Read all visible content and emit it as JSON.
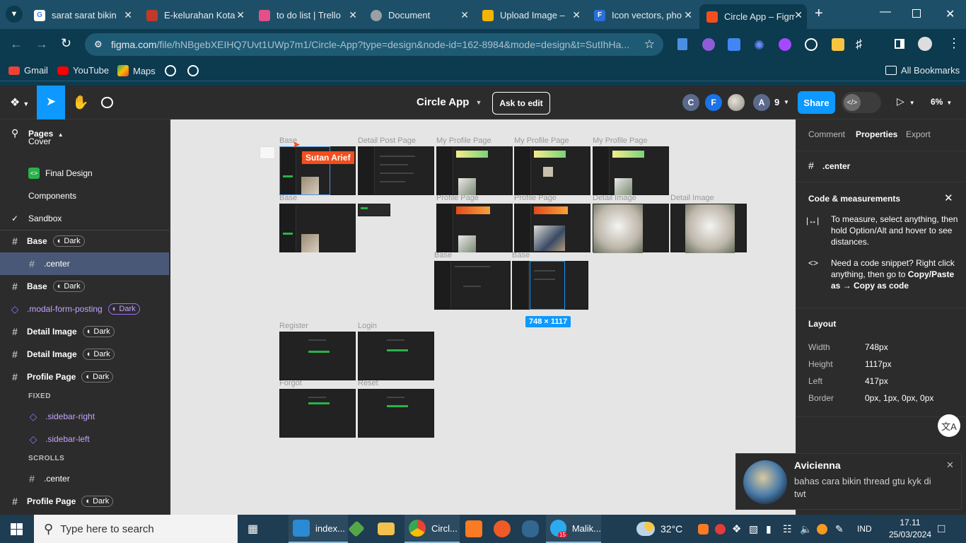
{
  "browser": {
    "tabs": [
      {
        "title": "sarat sarat bikin",
        "icon": "google-icon",
        "color": "#ffffff"
      },
      {
        "title": "E-kelurahan Kota",
        "icon": "site-icon",
        "color": "#c0392b"
      },
      {
        "title": "to do list | Trello",
        "icon": "trello-icon",
        "color": "#e44f8a"
      },
      {
        "title": "Document",
        "icon": "globe-icon",
        "color": "#9aa0a6"
      },
      {
        "title": "Upload Image –",
        "icon": "upload-icon",
        "color": "#f5b400"
      },
      {
        "title": "Icon vectors, pho",
        "icon": "flaticon-icon",
        "color": "#2a6fdb"
      },
      {
        "title": "Circle App – Figm",
        "icon": "figma-icon",
        "color": "#f24e1e"
      }
    ],
    "url_host": "figma.com",
    "url_path": "/file/hNBgebXEIHQ7Uvt1UWp7m1/Circle-App?type=design&node-id=162-8984&mode=design&t=SutIhHa...",
    "bookmarks": [
      {
        "label": "Gmail",
        "icon": "gmail-icon"
      },
      {
        "label": "YouTube",
        "icon": "youtube-icon"
      },
      {
        "label": "Maps",
        "icon": "maps-icon"
      }
    ],
    "all_bookmarks": "All Bookmarks"
  },
  "figma": {
    "file_name": "Circle App",
    "ask_to_edit": "Ask to edit",
    "share": "Share",
    "zoom": "6%",
    "avatars": [
      {
        "letter": "C",
        "color": "#5b6a8c"
      },
      {
        "letter": "F",
        "color": "#1a73e8"
      },
      {
        "letter": "",
        "color": "#8c8c8c"
      },
      {
        "letter": "A",
        "color": "#5b6a8c"
      }
    ],
    "avatar_count": "9"
  },
  "left": {
    "pages_label": "Pages",
    "pages": [
      {
        "label": "Cover"
      },
      {
        "label": "Final Design"
      },
      {
        "label": "Components"
      },
      {
        "label": "Sandbox"
      }
    ],
    "layers": [
      {
        "label": "Base",
        "badge": "Dark",
        "kind": "frame"
      },
      {
        "label": ".center",
        "badge": "",
        "kind": "frame-child"
      },
      {
        "label": "Base",
        "badge": "Dark",
        "kind": "frame"
      },
      {
        "label": ".modal-form-posting",
        "badge": "Dark",
        "kind": "component"
      },
      {
        "label": "Detail Image",
        "badge": "Dark",
        "kind": "frame"
      },
      {
        "label": "Detail Image",
        "badge": "Dark",
        "kind": "frame"
      },
      {
        "label": "Profile Page",
        "badge": "Dark",
        "kind": "frame"
      },
      {
        "label": "FIXED",
        "badge": "",
        "kind": "section"
      },
      {
        "label": ".sidebar-right",
        "badge": "",
        "kind": "component-child"
      },
      {
        "label": ".sidebar-left",
        "badge": "",
        "kind": "component-child"
      },
      {
        "label": "SCROLLS",
        "badge": "",
        "kind": "section"
      },
      {
        "label": ".center",
        "badge": "",
        "kind": "frame-child"
      },
      {
        "label": "Profile Page",
        "badge": "Dark",
        "kind": "frame"
      }
    ]
  },
  "canvas": {
    "frame_labels": [
      "Base",
      "Detail Post Page",
      "My Profile Page",
      "My Profile Page",
      "My Profile Page",
      "Base",
      "Profile Page",
      "Profile Page",
      "Detail Image",
      "Detail Image",
      "Base",
      "Base",
      "Register",
      "Login",
      "Forgot",
      "Reset"
    ],
    "cursor_name": "Sutan Arief",
    "selection_size": "748 × 1117"
  },
  "right": {
    "tabs": [
      "Comment",
      "Properties",
      "Export"
    ],
    "selected_name": ".center",
    "code_title": "Code & measurements",
    "measure_text": "To measure, select anything, then hold Option/Alt and hover to see distances.",
    "snippet_text_1": "Need a code snippet? Right click anything, then go to",
    "snippet_bold": "Copy/Paste as → Copy as code",
    "layout_title": "Layout",
    "props": [
      {
        "label": "Width",
        "value": "748px"
      },
      {
        "label": "Height",
        "value": "1117px"
      },
      {
        "label": "Left",
        "value": "417px"
      },
      {
        "label": "Border",
        "value": "0px, 1px, 0px, 0px"
      }
    ]
  },
  "notification": {
    "title": "Avicienna",
    "body": "bahas cara bikin thread gtu kyk di twt"
  },
  "taskbar": {
    "search_placeholder": "Type here to search",
    "apps": [
      {
        "label": "index...",
        "icon": "vscode-icon"
      },
      {
        "label": "",
        "icon": "node-icon"
      },
      {
        "label": "",
        "icon": "explorer-icon"
      },
      {
        "label": "Circl...",
        "icon": "chrome-icon"
      },
      {
        "label": "",
        "icon": "xampp-icon"
      },
      {
        "label": "",
        "icon": "postman-icon"
      },
      {
        "label": "",
        "icon": "postgres-icon"
      },
      {
        "label": "Malik...",
        "icon": "telegram-icon"
      }
    ],
    "telegram_badge": "15",
    "weather": "32°C",
    "language": "IND",
    "time": "17.11",
    "date": "25/03/2024"
  }
}
